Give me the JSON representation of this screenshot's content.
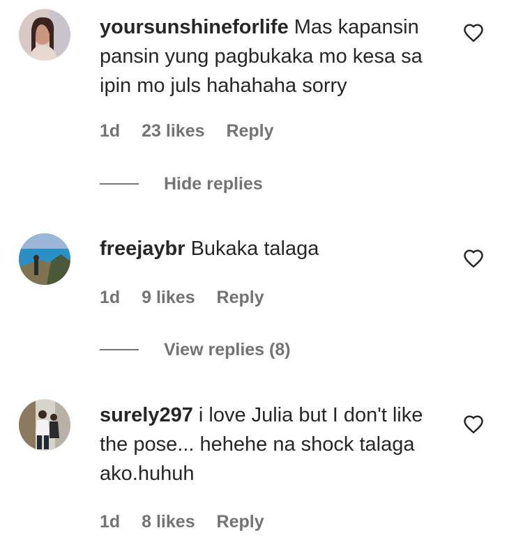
{
  "comments": [
    {
      "username": "yoursunshineforlife",
      "text": "Mas kapansin pansin yung pagbukaka mo kesa sa ipin mo juls hahahaha sorry",
      "time": "1d",
      "likes": "23 likes",
      "reply": "Reply",
      "replies_toggle": "Hide replies"
    },
    {
      "username": "freejaybr",
      "text": "Bukaka talaga",
      "time": "1d",
      "likes": "9 likes",
      "reply": "Reply",
      "replies_toggle": "View replies (8)"
    },
    {
      "username": "surely297",
      "text": "i love Julia but I don't like the pose... hehehe na shock talaga ako.huhuh",
      "time": "1d",
      "likes": "8 likes",
      "reply": "Reply"
    }
  ],
  "icons": {
    "like": "heart-outline-icon"
  },
  "colors": {
    "text_primary": "#262626",
    "text_secondary": "#737373"
  }
}
